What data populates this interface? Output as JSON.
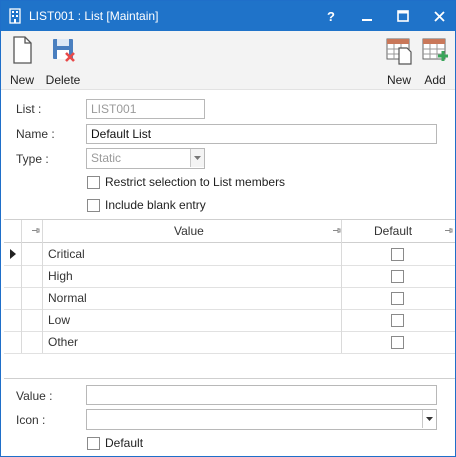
{
  "window": {
    "title": "LIST001 : List [Maintain]",
    "buttons": {
      "help": "?",
      "minimize": "–",
      "maximize": "□",
      "close": "✕"
    }
  },
  "toolbar": {
    "new_label": "New",
    "delete_label": "Delete",
    "grid_new_label": "New",
    "grid_add_label": "Add"
  },
  "form": {
    "list_label": "List :",
    "list_value": "LIST001",
    "name_label": "Name :",
    "name_value": "Default List",
    "type_label": "Type :",
    "type_value": "Static",
    "restrict_label": "Restrict selection to List members",
    "restrict_checked": false,
    "blank_label": "Include blank entry",
    "blank_checked": false
  },
  "grid": {
    "columns": [
      "Value",
      "Default"
    ],
    "rows": [
      {
        "value": "Critical",
        "default": false
      },
      {
        "value": "High",
        "default": false
      },
      {
        "value": "Normal",
        "default": false
      },
      {
        "value": "Low",
        "default": false
      },
      {
        "value": "Other",
        "default": false
      }
    ]
  },
  "detail": {
    "value_label": "Value :",
    "value_value": "",
    "icon_label": "Icon :",
    "icon_value": "",
    "default_label": "Default",
    "default_checked": false
  },
  "colors": {
    "titlebar": "#1f73c9",
    "accent_red": "#e84a4a",
    "accent_green": "#3aa55a"
  }
}
